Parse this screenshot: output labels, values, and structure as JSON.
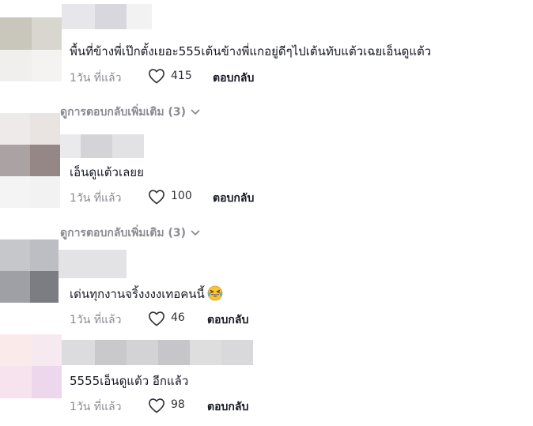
{
  "comments": [
    {
      "text": "พื้นที่ข้างพี่เป๊กตั้งเยอะ555เต้นข้างพี่แกอยู่ดีๆไปเต้นทับแต้วเฉยเอ็นดูแต้ว",
      "time": "1วัน ที่แล้ว",
      "likes": "415",
      "reply": "ตอบกลับ"
    },
    {
      "text": "เอ็นดูแต้วเลยย",
      "time": "1วัน ที่แล้ว",
      "likes": "100",
      "reply": "ตอบกลับ"
    },
    {
      "text": "เด่นทุกงานจริ้งงงงเทอคนนี้",
      "emoji": "grinning-squinting-face-with-tears",
      "time": "1วัน ที่แล้ว",
      "likes": "46",
      "reply": "ตอบกลับ"
    },
    {
      "text": "5555เอ็นดูแต้ว อีกแล้ว",
      "time": "1วัน ที่แล้ว",
      "likes": "98",
      "reply": "ตอบกลับ"
    }
  ],
  "view_more": [
    {
      "label": "ดูการตอบกลับเพิ่มเติม (3)"
    },
    {
      "label": "ดูการตอบกลับเพิ่มเติม (3)"
    }
  ],
  "icons": {
    "heart": "heart-outline-icon",
    "chevron": "chevron-down-icon"
  },
  "colors": {
    "text": "#161823",
    "meta": "#8a8b91",
    "background": "#ffffff"
  }
}
